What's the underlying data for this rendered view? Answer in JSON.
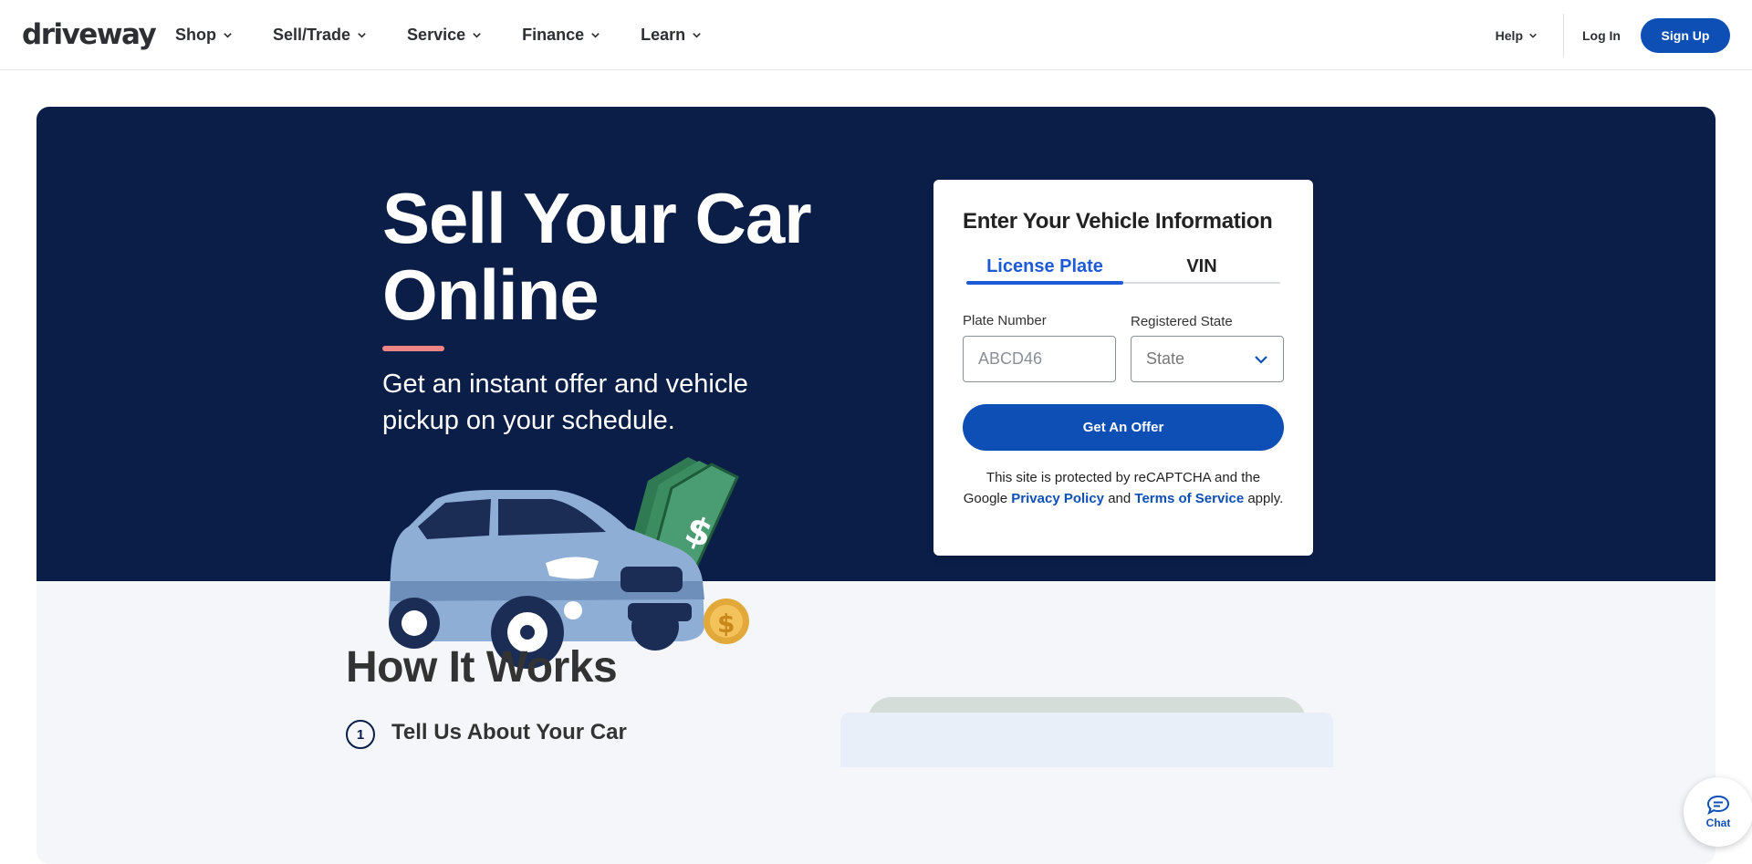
{
  "header": {
    "logo": "driveway",
    "nav": [
      {
        "label": "Shop"
      },
      {
        "label": "Sell/Trade"
      },
      {
        "label": "Service"
      },
      {
        "label": "Finance"
      },
      {
        "label": "Learn"
      }
    ],
    "help_label": "Help",
    "login_label": "Log In",
    "signup_label": "Sign Up"
  },
  "hero": {
    "title": "Sell Your Car Online",
    "subtitle": "Get an instant offer and vehicle pickup on your schedule."
  },
  "form": {
    "title": "Enter Your Vehicle Information",
    "tabs": [
      {
        "label": "License Plate",
        "active": true
      },
      {
        "label": "VIN",
        "active": false
      }
    ],
    "plate_label": "Plate Number",
    "plate_placeholder": "ABCD46",
    "state_label": "Registered State",
    "state_value": "State",
    "submit_label": "Get An Offer",
    "legal_prefix": "This site is protected by reCAPTCHA and the Google",
    "privacy_label": "Privacy Policy",
    "legal_and": "and",
    "terms_label": "Terms of Service",
    "legal_suffix": "apply."
  },
  "how_it_works": {
    "title": "How It Works",
    "steps": [
      {
        "number": "1",
        "title": "Tell Us About Your Car"
      }
    ]
  },
  "chat": {
    "label": "Chat"
  },
  "colors": {
    "brand_blue": "#0e4fb5",
    "hero_navy": "#0b1e48",
    "accent_pink": "#f08585",
    "link_blue": "#1d5bd6"
  }
}
